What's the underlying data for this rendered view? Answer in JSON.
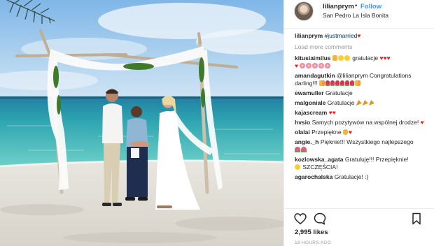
{
  "header": {
    "username": "lilianprym",
    "separator": "•",
    "follow_label": "Follow",
    "location": "San Pedro La Isla Bonita"
  },
  "caption": {
    "username": "lilianprym",
    "text": "#justmarried"
  },
  "load_more": "Load more comments",
  "comments": [
    {
      "username": "kitusiaimilus",
      "text": "gratulacje",
      "emoji_before": [
        "thumbs-up",
        "grinning-face",
        "smiling-face"
      ],
      "emoji_after": [
        "heart",
        "heart",
        "heart",
        "heart",
        "cherry-blossom",
        "cherry-blossom",
        "cherry-blossom",
        "cherry-blossom",
        "cherry-blossom"
      ]
    },
    {
      "username": "amandagutkin",
      "text": "@lilianprym Congratulations darling!!!",
      "emoji_after": [
        "couple",
        "rose",
        "rose",
        "rose",
        "rose",
        "rose",
        "rose",
        "couple"
      ]
    },
    {
      "username": "ewamuller",
      "text": "Gratulacje"
    },
    {
      "username": "malgoniale",
      "text": "Gratulacje",
      "emoji_after": [
        "party-popper",
        "party-popper",
        "party-popper"
      ]
    },
    {
      "username": "kajascream",
      "text": "",
      "emoji_after": [
        "heart",
        "heart"
      ]
    },
    {
      "username": "hvsio",
      "text": "Samych pozytywów na wspólnej drodze!",
      "emoji_after": [
        "heart"
      ]
    },
    {
      "username": "olalai",
      "text": "Przepiękne",
      "emoji_after": [
        "raised-hand",
        "heart"
      ]
    },
    {
      "username": "angie._h",
      "text": "Pięknie!!! Wszystkiego najlepszego",
      "emoji_after": [
        "bouquet",
        "bouquet"
      ]
    },
    {
      "username": "kozlowska_agata",
      "text": "Gratuluję!!! Przepięknie!",
      "emoji_mid": [
        "smiling-face"
      ],
      "text2": "SZCZĘŚCIA!"
    },
    {
      "username": "agarochalska",
      "text": "Gratulacje! :)"
    }
  ],
  "actions": {
    "like_icon": "heart-outline-icon",
    "comment_icon": "speech-bubble-icon",
    "save_icon": "bookmark-icon"
  },
  "likes": "2,995 likes",
  "time_ago": "18 HOURS AGO",
  "colors": {
    "link": "#3897f0",
    "heart": "#ed1c24",
    "muted": "#999999",
    "text": "#262626"
  }
}
